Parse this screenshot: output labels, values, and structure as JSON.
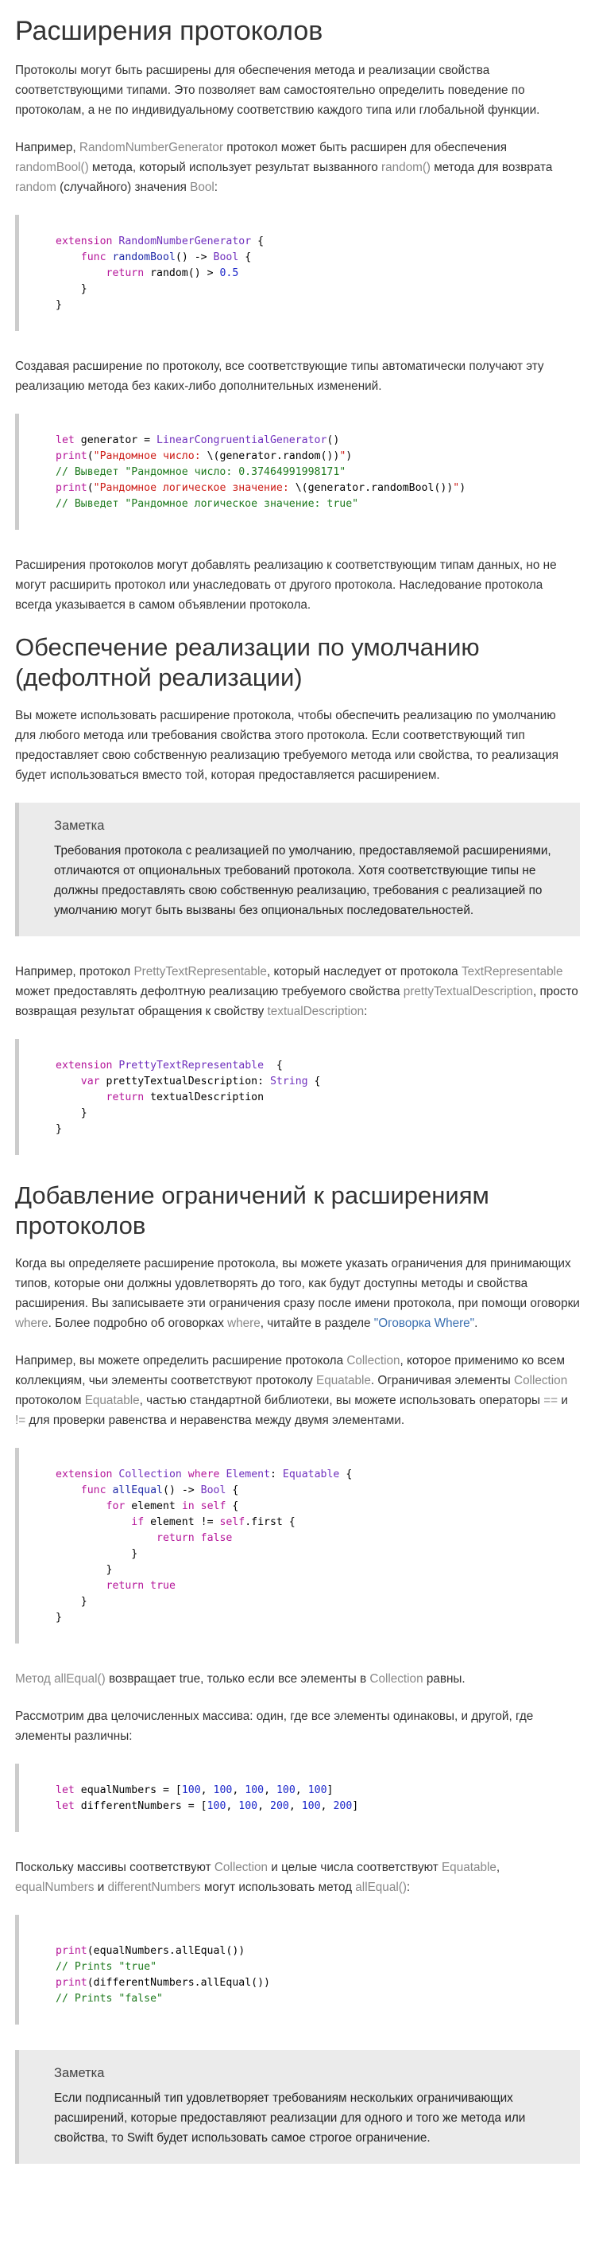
{
  "s1": {
    "title": "Расширения протоколов",
    "p1": "Протоколы могут быть расширены для обеспечения метода и реализации свойства соответствующими типами. Это позволяет вам самостоятельно определить поведение по протоколам, а не по индивидуальному соответствию каждого типа или глобальной функции.",
    "p2": [
      "Например, ",
      "RandomNumberGenerator",
      " протокол может быть расширен для обеспечения ",
      "randomBool()",
      " метода, который использует результат вызванного ",
      "random()",
      " метода для возврата ",
      "random",
      " (случайного) значения ",
      "Bool",
      ":"
    ],
    "code1": [
      "extension",
      " ",
      "RandomNumberGenerator",
      " {",
      "func",
      " ",
      "randomBool",
      "() -> ",
      "Bool",
      " {",
      "return",
      " random() > ",
      "0.5",
      "}",
      "}"
    ],
    "p3": "Создавая расширение по протоколу, все соответствующие типы автоматически получают эту реализацию метода без каких-либо дополнительных изменений.",
    "code2": [
      "let",
      " generator = ",
      "LinearCongruentialGenerator",
      "()",
      "print",
      "(",
      "\"Рандомное число: ",
      "\\(generator.random())",
      "\"",
      ")",
      "// Выведет \"Рандомное число: 0.37464991998171\"",
      "print",
      "(",
      "\"Рандомное логическое значение: ",
      "\\(generator.randomBool())",
      "\"",
      ")",
      "// Выведет \"Рандомное логическое значение: true\""
    ],
    "p4": "Расширения протоколов могут добавлять реализацию к соответствующим типам данных, но не могут расширить протокол или унаследовать от другого протокола. Наследование протокола всегда указывается в самом объявлении протокола."
  },
  "s2": {
    "title": "Обеспечение реализации по умолчанию (дефолтной реализации)",
    "p1": "Вы можете использовать расширение протокола, чтобы обеспечить реализацию по умолчанию для любого метода или требования свойства этого протокола. Если соответствующий тип предоставляет свою собственную реализацию требуемого метода или свойства, то реализация будет использоваться вместо той, которая предоставляется расширением.",
    "note_title": "Заметка",
    "note_body": "Требования протокола с реализацией по умолчанию, предоставляемой расширениями, отличаются от опциональных требований протокола. Хотя соответствующие типы не должны предоставлять свою собственную реализацию, требования с реализацией по умолчанию могут быть вызваны без опциональных последовательностей.",
    "p2": [
      "Например, протокол ",
      "PrettyTextRepresentable",
      ", который наследует от протокола ",
      "TextRepresentable",
      " может предоставлять дефолтную реализацию требуемого свойства ",
      "prettyTextualDescription",
      ", просто возвращая результат обращения к свойству ",
      "textualDescription",
      ":"
    ],
    "code": [
      "extension",
      " ",
      "PrettyTextRepresentable",
      "  {",
      "var",
      " prettyTextualDescription: ",
      "String",
      " {",
      "return",
      " textualDescription",
      "}",
      "}"
    ]
  },
  "s3": {
    "title": "Добавление ограничений к расширениям протоколов",
    "p1": [
      "Когда вы определяете расширение протокола, вы можете указать ограничения для принимающих типов, которые они должны удовлетворять до того, как будут доступны методы и свойства расширения. Вы записываете эти ограничения сразу после имени протокола, при помощи оговорки ",
      "where",
      ". Более подробно об оговорках ",
      "where",
      ", читайте в разделе ",
      "\"Оговорка Where\"",
      "."
    ],
    "p2": [
      "Например, вы можете определить расширение протокола ",
      "Collection",
      ", которое применимо ко всем коллекциям, чьи элементы соответствуют протоколу ",
      "Equatable",
      ". Ограничивая элементы ",
      "Collection",
      " протоколом ",
      "Equatable",
      ", частью стандартной библиотеки, вы можете использовать операторы ",
      "==",
      " и ",
      "!=",
      " для проверки равенства и неравенства между двумя элементами."
    ],
    "code1": [
      "extension",
      " ",
      "Collection",
      " ",
      "where",
      " ",
      "Element",
      ": ",
      "Equatable",
      " {",
      "func",
      " ",
      "allEqual",
      "() -> ",
      "Bool",
      " {",
      "for",
      " element ",
      "in",
      " ",
      "self",
      " {",
      "if",
      " element != ",
      "self",
      ".first {",
      "return",
      " ",
      "false",
      "}",
      "}",
      "return",
      " ",
      "true",
      "}",
      "}"
    ],
    "p3": [
      "Метод ",
      "allEqual()",
      " возвращает true, только если все элементы в ",
      "Collection",
      " равны."
    ],
    "p4": "Рассмотрим два целочисленных массива: один, где все элементы одинаковы, и другой, где элементы различны:",
    "code2": [
      "let",
      " equalNumbers = [",
      "100",
      ", ",
      "100",
      ", ",
      "100",
      ", ",
      "100",
      ", ",
      "100",
      "]",
      "let",
      " differentNumbers = [",
      "100",
      ", ",
      "100",
      ", ",
      "200",
      ", ",
      "100",
      ", ",
      "200",
      "]"
    ],
    "p5": [
      "Поскольку массивы соответствуют ",
      "Collection",
      " и целые числа соответствуют ",
      "Equatable",
      ", ",
      "equalNumbers",
      " и ",
      "differentNumbers",
      " могут использовать метод ",
      "allEqual()",
      ":"
    ],
    "code3": [
      "print",
      "(equalNumbers.allEqual())",
      "// Prints \"true\"",
      "print",
      "(differentNumbers.allEqual())",
      "// Prints \"false\""
    ],
    "note_title": "Заметка",
    "note_body": "Если подписанный тип удовлетворяет требованиям нескольких ограничивающих расширений, которые предоставляют реализации для одного и того же метода или свойства, то Swift будет использовать самое строгое ограничение."
  }
}
